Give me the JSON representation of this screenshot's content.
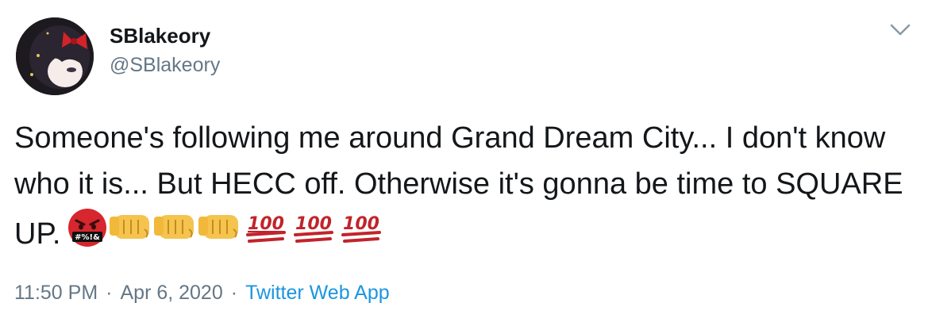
{
  "user": {
    "display_name": "SBlakeory",
    "handle": "@SBlakeory"
  },
  "tweet": {
    "text": "Someone's following me around Grand Dream City... I don't know who it is... But HECC off. Otherwise it's gonna be time to SQUARE UP.",
    "emojis": [
      "angry-swearing-face",
      "fist-bump",
      "fist-bump",
      "fist-bump",
      "hundred-points",
      "hundred-points",
      "hundred-points"
    ],
    "swear_symbols": "#%!&",
    "hundred_label": "100"
  },
  "meta": {
    "time": "11:50 PM",
    "separator": "·",
    "date": "Apr 6, 2020",
    "source": "Twitter Web App"
  },
  "colors": {
    "text": "#14171a",
    "secondary": "#657786",
    "link": "#1b95e0"
  }
}
